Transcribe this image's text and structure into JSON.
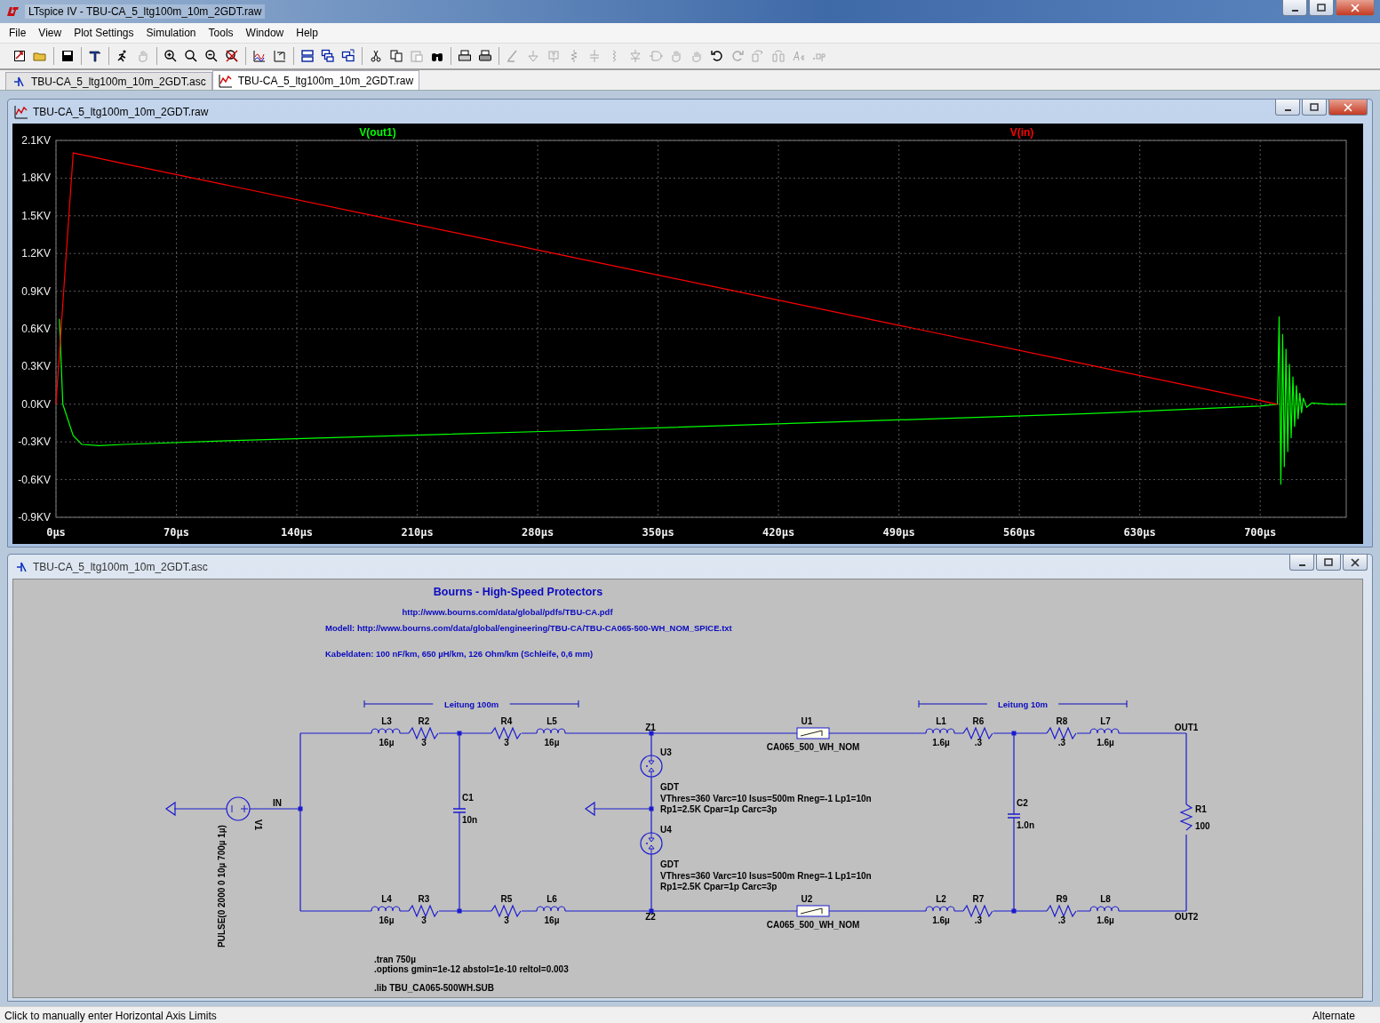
{
  "window": {
    "title": "LTspice IV - TBU-CA_5_ltg100m_10m_2GDT.raw"
  },
  "menu": [
    "File",
    "View",
    "Plot Settings",
    "Simulation",
    "Tools",
    "Window",
    "Help"
  ],
  "toolbar": [
    {
      "disabled": false
    },
    {
      "disabled": false
    },
    {
      "disabled": false
    },
    {
      "disabled": false
    },
    {
      "disabled": false
    },
    {
      "disabled": true
    },
    {
      "disabled": false
    },
    {
      "disabled": false
    },
    {
      "disabled": false
    },
    {
      "disabled": false
    },
    {
      "disabled": false
    },
    {
      "disabled": false
    },
    {
      "disabled": false
    },
    {
      "disabled": false
    },
    {
      "disabled": false
    },
    {
      "disabled": false
    },
    {
      "disabled": false
    },
    {
      "disabled": true
    },
    {
      "disabled": false
    },
    {
      "disabled": false
    },
    {
      "disabled": false
    },
    {
      "disabled": true
    },
    {
      "disabled": true
    },
    {
      "disabled": true
    },
    {
      "disabled": true
    },
    {
      "disabled": true
    },
    {
      "disabled": true
    },
    {
      "disabled": true
    },
    {
      "disabled": true
    },
    {
      "disabled": true
    },
    {
      "disabled": true
    },
    {
      "disabled": false
    },
    {
      "disabled": true
    },
    {
      "disabled": true
    },
    {
      "disabled": true
    },
    {
      "disabled": true
    },
    {
      "disabled": true
    }
  ],
  "doc_tabs": [
    {
      "kind": "schematic",
      "label": "TBU-CA_5_ltg100m_10m_2GDT.asc",
      "selected": false
    },
    {
      "kind": "waveform",
      "label": "TBU-CA_5_ltg100m_10m_2GDT.raw",
      "selected": true
    }
  ],
  "plot": {
    "title": "TBU-CA_5_ltg100m_10m_2GDT.raw",
    "active": true,
    "chart_data": {
      "type": "line",
      "x": [
        0,
        1,
        2,
        4,
        10,
        15,
        25,
        40,
        100,
        200,
        300,
        400,
        500,
        600,
        700,
        710,
        711,
        712,
        713,
        714,
        715,
        716,
        717,
        718,
        719,
        720,
        721,
        722,
        723,
        724,
        725,
        727,
        730,
        740,
        750
      ],
      "series": [
        {
          "name": "V(out1)",
          "color": "#00ff00",
          "values": [
            null,
            null,
            0.68,
            0,
            -0.25,
            -0.32,
            -0.33,
            -0.32,
            -0.29,
            -0.25,
            -0.21,
            -0.165,
            -0.12,
            -0.075,
            -0.015,
            0,
            0.7,
            -0.64,
            0.56,
            -0.5,
            0.44,
            -0.38,
            0.32,
            -0.27,
            0.22,
            -0.18,
            0.15,
            -0.12,
            0.09,
            -0.07,
            0.05,
            -0.025,
            0.01,
            0,
            0
          ]
        },
        {
          "name": "V(in)",
          "color": "#ff0000",
          "values": [
            0,
            0.2,
            0.4,
            0.8,
            2.0,
            1.986,
            1.957,
            1.914,
            1.743,
            1.457,
            1.171,
            0.886,
            0.6,
            0.314,
            0.029,
            0,
            null,
            null,
            null,
            null,
            null,
            null,
            null,
            null,
            null,
            null,
            null,
            null,
            null,
            null,
            null,
            null,
            null,
            null,
            null
          ]
        }
      ],
      "grid": true,
      "xlim": [
        0,
        750
      ],
      "ylim": [
        -0.9,
        2.1
      ],
      "xticks": [
        {
          "value": 0,
          "label": "0µs"
        },
        {
          "value": 70,
          "label": "70µs"
        },
        {
          "value": 140,
          "label": "140µs"
        },
        {
          "value": 210,
          "label": "210µs"
        },
        {
          "value": 280,
          "label": "280µs"
        },
        {
          "value": 350,
          "label": "350µs"
        },
        {
          "value": 420,
          "label": "420µs"
        },
        {
          "value": 490,
          "label": "490µs"
        },
        {
          "value": 560,
          "label": "560µs"
        },
        {
          "value": 630,
          "label": "630µs"
        },
        {
          "value": 700,
          "label": "700µs"
        }
      ],
      "yticks": [
        {
          "value": 2.1,
          "label": "2.1KV"
        },
        {
          "value": 1.8,
          "label": "1.8KV"
        },
        {
          "value": 1.5,
          "label": "1.5KV"
        },
        {
          "value": 1.2,
          "label": "1.2KV"
        },
        {
          "value": 0.9,
          "label": "0.9KV"
        },
        {
          "value": 0.6,
          "label": "0.6KV"
        },
        {
          "value": 0.3,
          "label": "0.3KV"
        },
        {
          "value": 0,
          "label": "0.0KV"
        },
        {
          "value": -0.3,
          "label": "-0.3KV"
        },
        {
          "value": -0.6,
          "label": "-0.6KV"
        },
        {
          "value": -0.9,
          "label": "-0.9KV"
        }
      ]
    }
  },
  "schematic": {
    "title": "TBU-CA_5_ltg100m_10m_2GDT.asc",
    "active": false,
    "heading": "Bourns - High-Speed Protectors",
    "link": "http://www.bourns.com/data/global/pdfs/TBU-CA.pdf",
    "model_note": "Modell: http://www.bourns.com/data/global/engineering/TBU-CA/TBU-CA065-500-WH_NOM_SPICE.txt",
    "cable_note": "Kabeldaten: 100 nF/km, 650 µH/km, 126 Ohm/km (Schleife, 0,6 mm)",
    "segments": [
      {
        "label": "Leitung 100m"
      },
      {
        "label": "Leitung 10m"
      }
    ],
    "components": [
      {
        "kind": "inductor",
        "ref": "L3",
        "value": "16µ"
      },
      {
        "kind": "resistor",
        "ref": "R2",
        "value": "3"
      },
      {
        "kind": "resistor",
        "ref": "R4",
        "value": "3"
      },
      {
        "kind": "inductor",
        "ref": "L5",
        "value": "16µ"
      },
      {
        "kind": "tbu",
        "ref": "U1",
        "value": "CA065_500_WH_NOM"
      },
      {
        "kind": "inductor",
        "ref": "L1",
        "value": "1.6µ"
      },
      {
        "kind": "resistor",
        "ref": "R6",
        "value": ".3"
      },
      {
        "kind": "resistor",
        "ref": "R8",
        "value": ".3"
      },
      {
        "kind": "inductor",
        "ref": "L7",
        "value": "1.6µ"
      },
      {
        "kind": "inductor",
        "ref": "L4",
        "value": "16µ"
      },
      {
        "kind": "resistor",
        "ref": "R3",
        "value": "3"
      },
      {
        "kind": "resistor",
        "ref": "R5",
        "value": "3"
      },
      {
        "kind": "inductor",
        "ref": "L6",
        "value": "16µ"
      },
      {
        "kind": "tbu",
        "ref": "U2",
        "value": "CA065_500_WH_NOM"
      },
      {
        "kind": "inductor",
        "ref": "L2",
        "value": "1.6µ"
      },
      {
        "kind": "resistor",
        "ref": "R7",
        "value": ".3"
      },
      {
        "kind": "resistor",
        "ref": "R9",
        "value": ".3"
      },
      {
        "kind": "inductor",
        "ref": "L8",
        "value": "1.6µ"
      },
      {
        "kind": "capacitor",
        "ref": "C1",
        "value": "10n"
      },
      {
        "kind": "capacitor",
        "ref": "C2",
        "value": "1.0n"
      },
      {
        "kind": "resistor",
        "ref": "R1",
        "value": "100"
      }
    ],
    "gdts": [
      {
        "ref": "U3",
        "model": "GDT",
        "params": [
          "VThres=360 Varc=10 Isus=500m Rneg=-1 Lp1=10n",
          "Rp1=2.5K Cpar=1p Carc=3p"
        ]
      },
      {
        "ref": "U4",
        "model": "GDT",
        "params": [
          "VThres=360 Varc=10 Isus=500m Rneg=-1 Lp1=10n",
          "Rp1=2.5K Cpar=1p Carc=3p"
        ]
      }
    ],
    "source": {
      "ref": "V1",
      "value": "PULSE(0 2000 0 10µ 700µ 1µ)"
    },
    "net_labels": [
      "IN",
      "Z1",
      "Z2",
      "OUT1",
      "OUT2"
    ],
    "directives": [
      ".tran 750µ",
      ".options gmin=1e-12 abstol=1e-10 reltol=0.003",
      ".lib TBU_CA065-500WH.SUB"
    ]
  },
  "status_bar": {
    "message": "Click to manually enter Horizontal Axis Limits",
    "mode": "Alternate"
  }
}
